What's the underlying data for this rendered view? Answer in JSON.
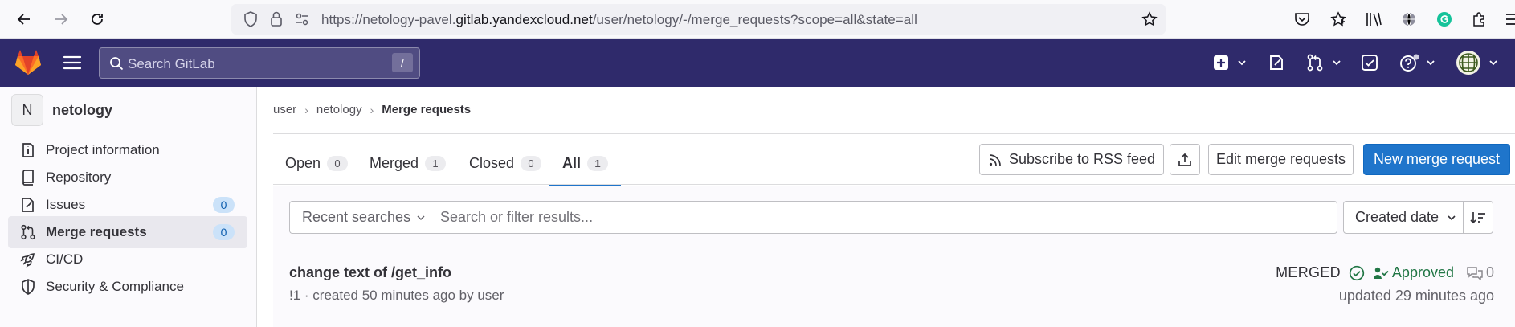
{
  "browser": {
    "url_prefix": "https://netology-pavel.",
    "url_host": "gitlab.yandexcloud.net",
    "url_path": "/user/netology/-/merge_requests?scope=all&state=all",
    "icons": [
      "back-icon",
      "forward-icon",
      "reload-icon",
      "shield-icon",
      "lock-icon",
      "permissions-icon",
      "bookmark-star-icon",
      "pocket-icon",
      "extension-star-icon",
      "library-icon",
      "globe-icon",
      "grammarly-icon",
      "extensions-icon"
    ]
  },
  "topnav": {
    "search_placeholder": "Search GitLab",
    "search_shortcut": "/",
    "colors": {
      "nav_bg": "#2f2a6b",
      "accent": "#1f75cb"
    }
  },
  "sidebar": {
    "project_initial": "N",
    "project_name": "netology",
    "items": [
      {
        "label": "Project information",
        "icon": "project-info-icon"
      },
      {
        "label": "Repository",
        "icon": "repository-icon"
      },
      {
        "label": "Issues",
        "icon": "issues-icon",
        "count": "0"
      },
      {
        "label": "Merge requests",
        "icon": "merge-request-icon",
        "count": "0",
        "active": true
      },
      {
        "label": "CI/CD",
        "icon": "rocket-icon"
      },
      {
        "label": "Security & Compliance",
        "icon": "shield-icon"
      }
    ]
  },
  "breadcrumb": {
    "items": [
      "user",
      "netology"
    ],
    "current": "Merge requests"
  },
  "tabs": [
    {
      "label": "Open",
      "count": "0"
    },
    {
      "label": "Merged",
      "count": "1"
    },
    {
      "label": "Closed",
      "count": "0"
    },
    {
      "label": "All",
      "count": "1",
      "active": true
    }
  ],
  "actions": {
    "rss": "Subscribe to RSS feed",
    "edit": "Edit merge requests",
    "new": "New merge request"
  },
  "filter": {
    "recent_label": "Recent searches",
    "placeholder": "Search or filter results...",
    "sort_label": "Created date"
  },
  "merge_request": {
    "title": "change text of /get_info",
    "meta": "!1 · created 50 minutes ago by user",
    "status": "MERGED",
    "approval": "Approved",
    "comments": "0",
    "updated": "updated 29 minutes ago"
  }
}
